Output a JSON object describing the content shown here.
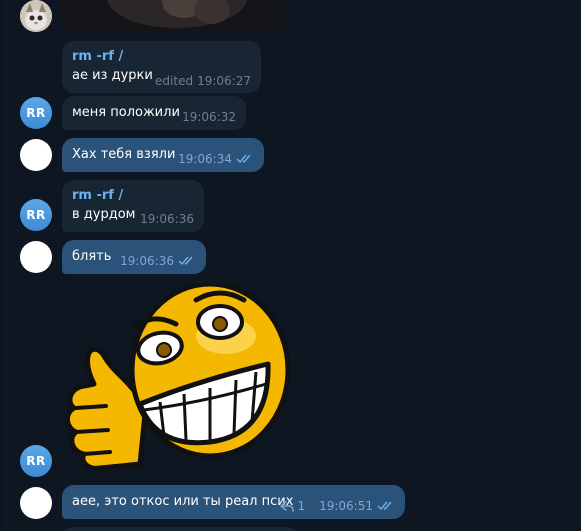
{
  "messages": [
    {
      "id": "m1",
      "sender": "rm -rf /",
      "text": "ае из дурки",
      "edited": "edited",
      "time": "19:06:27",
      "direction": "in"
    },
    {
      "id": "m2",
      "avatar": "RR",
      "text": "меня положили",
      "time": "19:06:32",
      "direction": "in"
    },
    {
      "id": "m3",
      "text": "Хах тебя взяли",
      "time": "19:06:34",
      "direction": "out"
    },
    {
      "id": "m4",
      "sender": "rm -rf /",
      "avatar": "RR",
      "text": "в дурдом",
      "time": "19:06:36",
      "direction": "in"
    },
    {
      "id": "m5",
      "text": "блять",
      "time": "19:06:36",
      "direction": "out"
    },
    {
      "id": "m6",
      "avatar": "RR",
      "type": "sticker",
      "sticker": "thumbs-up-smiley-sticker"
    },
    {
      "id": "m7",
      "text": "аее, это откос или ты реал псих",
      "replies": "1",
      "time": "19:06:51",
      "direction": "out"
    }
  ],
  "icons": {
    "read": "double-check-icon",
    "reply": "reply-arrow-icon"
  },
  "colors": {
    "background": "#0e1621",
    "incoming_bubble": "#182533",
    "outgoing_bubble": "#2b5278",
    "sender_name": "#6ab3f3",
    "avatar_rr": "#4a9ae0",
    "sticker_face": "#f5b800"
  }
}
